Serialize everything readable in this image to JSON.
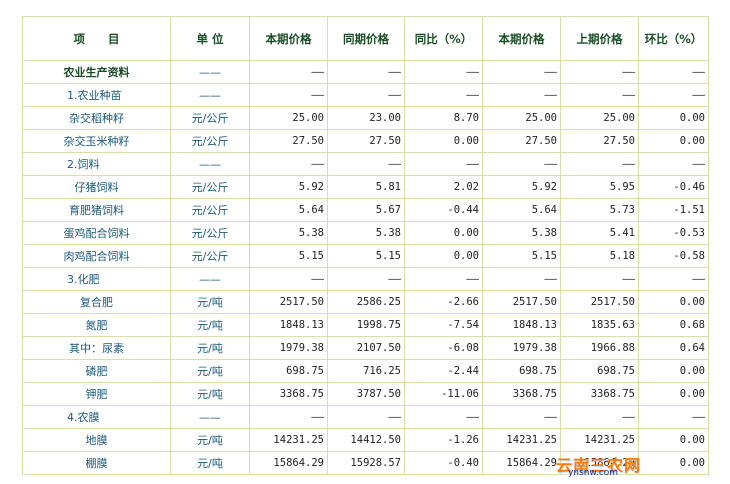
{
  "header": [
    "项　　目",
    "单 位",
    "本期价格",
    "同期价格",
    "同比（%）",
    "本期价格",
    "上期价格",
    "环比（%）"
  ],
  "rows": [
    {
      "type": "cat",
      "item": "农业生产资料",
      "unit": "——",
      "v": [
        "——",
        "——",
        "——",
        "——",
        "——",
        "——"
      ]
    },
    {
      "type": "sub",
      "item": "1.农业种苗",
      "unit": "——",
      "v": [
        "——",
        "——",
        "——",
        "——",
        "——",
        "——"
      ]
    },
    {
      "type": "row",
      "item": "杂交稻种籽",
      "unit": "元/公斤",
      "v": [
        "25.00",
        "23.00",
        "8.70",
        "25.00",
        "25.00",
        "0.00"
      ]
    },
    {
      "type": "row",
      "item": "杂交玉米种籽",
      "unit": "元/公斤",
      "v": [
        "27.50",
        "27.50",
        "0.00",
        "27.50",
        "27.50",
        "0.00"
      ]
    },
    {
      "type": "sub",
      "item": "2.饲料",
      "unit": "——",
      "v": [
        "——",
        "——",
        "——",
        "——",
        "——",
        "——"
      ]
    },
    {
      "type": "row",
      "item": "仔猪饲料",
      "unit": "元/公斤",
      "v": [
        "5.92",
        "5.81",
        "2.02",
        "5.92",
        "5.95",
        "-0.46"
      ]
    },
    {
      "type": "row",
      "item": "育肥猪饲料",
      "unit": "元/公斤",
      "v": [
        "5.64",
        "5.67",
        "-0.44",
        "5.64",
        "5.73",
        "-1.51"
      ]
    },
    {
      "type": "row",
      "item": "蛋鸡配合饲料",
      "unit": "元/公斤",
      "v": [
        "5.38",
        "5.38",
        "0.00",
        "5.38",
        "5.41",
        "-0.53"
      ]
    },
    {
      "type": "row",
      "item": "肉鸡配合饲料",
      "unit": "元/公斤",
      "v": [
        "5.15",
        "5.15",
        "0.00",
        "5.15",
        "5.18",
        "-0.58"
      ]
    },
    {
      "type": "sub",
      "item": "3.化肥",
      "unit": "——",
      "v": [
        "——",
        "——",
        "——",
        "——",
        "——",
        "——"
      ]
    },
    {
      "type": "row",
      "item": "复合肥",
      "unit": "元/吨",
      "v": [
        "2517.50",
        "2586.25",
        "-2.66",
        "2517.50",
        "2517.50",
        "0.00"
      ]
    },
    {
      "type": "row",
      "item": "氮肥",
      "unit": "元/吨",
      "v": [
        "1848.13",
        "1998.75",
        "-7.54",
        "1848.13",
        "1835.63",
        "0.68"
      ]
    },
    {
      "type": "row",
      "item": "其中：尿素",
      "unit": "元/吨",
      "v": [
        "1979.38",
        "2107.50",
        "-6.08",
        "1979.38",
        "1966.88",
        "0.64"
      ]
    },
    {
      "type": "row",
      "item": "磷肥",
      "unit": "元/吨",
      "v": [
        "698.75",
        "716.25",
        "-2.44",
        "698.75",
        "698.75",
        "0.00"
      ]
    },
    {
      "type": "row",
      "item": "钾肥",
      "unit": "元/吨",
      "v": [
        "3368.75",
        "3787.50",
        "-11.06",
        "3368.75",
        "3368.75",
        "0.00"
      ]
    },
    {
      "type": "sub",
      "item": "4.农膜",
      "unit": "——",
      "v": [
        "——",
        "——",
        "——",
        "——",
        "——",
        "——"
      ]
    },
    {
      "type": "row",
      "item": "地膜",
      "unit": "元/吨",
      "v": [
        "14231.25",
        "14412.50",
        "-1.26",
        "14231.25",
        "14231.25",
        "0.00"
      ]
    },
    {
      "type": "row",
      "item": "棚膜",
      "unit": "元/吨",
      "v": [
        "15864.29",
        "15928.57",
        "-0.40",
        "15864.29",
        "15864.29",
        "0.00"
      ]
    }
  ],
  "watermark": {
    "text": "云南三农网",
    "url_text": "ynsnw.com"
  }
}
